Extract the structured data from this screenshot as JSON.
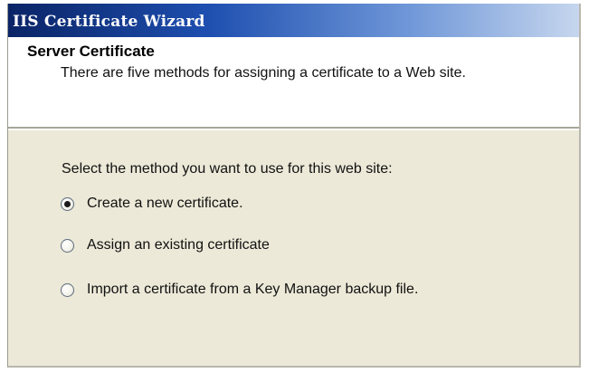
{
  "window": {
    "title": "IIS Certificate Wizard"
  },
  "header": {
    "title": "Server Certificate",
    "subtitle": "There are five methods for assigning a certificate to a Web site."
  },
  "main": {
    "prompt": "Select the method you want to use for this web site:",
    "options": [
      {
        "label": "Create a new certificate.",
        "selected": true
      },
      {
        "label": "Assign an existing certificate",
        "selected": false
      },
      {
        "label": "Import a certificate from a Key Manager backup file.",
        "selected": false
      }
    ]
  },
  "colors": {
    "titlebar_start": "#0a2466",
    "titlebar_end": "#c6d6ee",
    "dialog_background": "#ece9d8",
    "header_background": "#ffffff"
  }
}
